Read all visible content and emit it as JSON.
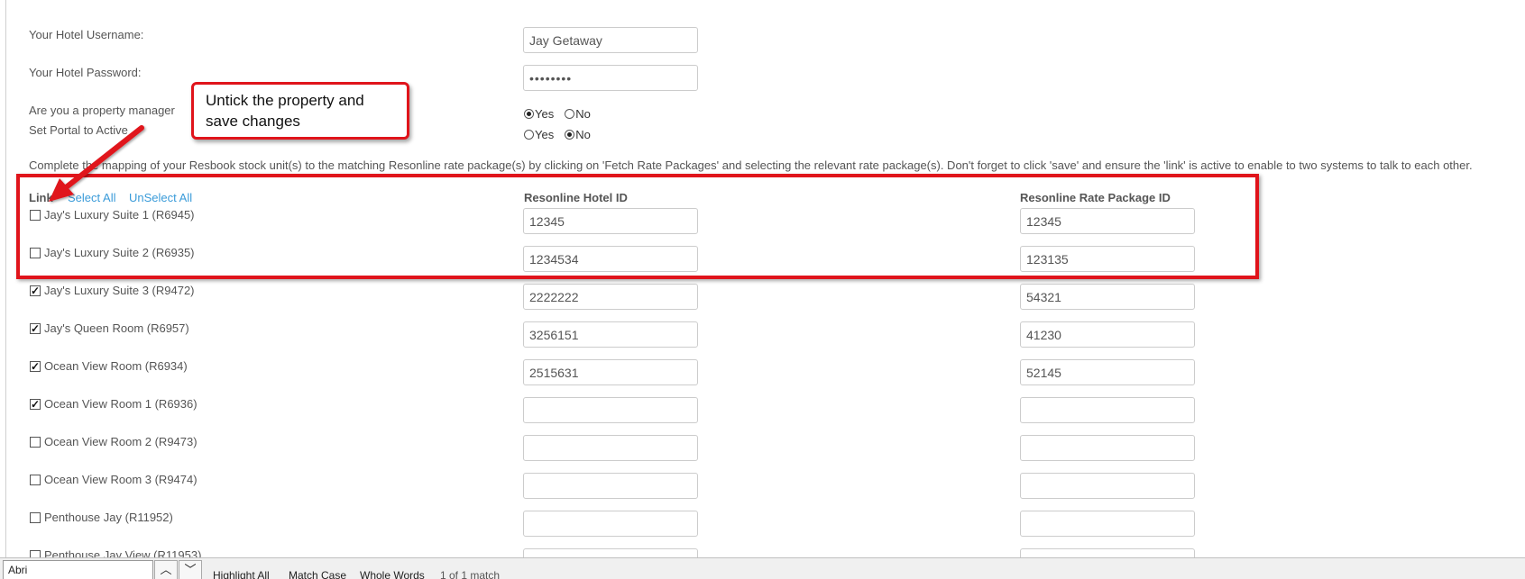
{
  "form": {
    "username_label": "Your Hotel Username:",
    "username_value": "Jay Getaway",
    "password_label": "Your Hotel Password:",
    "password_value": "••••••••",
    "property_manager_label": "Are you a property manager",
    "property_manager": {
      "yes": "Yes",
      "no": "No",
      "selected": "Yes"
    },
    "portal_active_label": "Set Portal to Active",
    "portal_active": {
      "yes": "Yes",
      "no": "No",
      "selected": "No"
    },
    "instructions": "Complete the mapping of your Resbook stock unit(s) to the matching Resonline rate package(s) by clicking on 'Fetch Rate Packages' and selecting the relevant rate package(s). Don't forget to click 'save' and ensure the 'link' is active to enable to two systems to talk to each other."
  },
  "mapping": {
    "link_header": "Link",
    "select_all": "Select All",
    "unselect_all": "UnSelect All",
    "hotel_id_header": "Resonline Hotel ID",
    "rate_package_header": "Resonline Rate Package ID",
    "rows": [
      {
        "label": "Jay's Luxury Suite 1 (R6945)",
        "checked": false,
        "hotel_id": "12345",
        "rate_id": "12345"
      },
      {
        "label": "Jay's Luxury Suite 2 (R6935)",
        "checked": false,
        "hotel_id": "1234534",
        "rate_id": "123135"
      },
      {
        "label": "Jay's Luxury Suite 3 (R9472)",
        "checked": true,
        "hotel_id": "2222222",
        "rate_id": "54321"
      },
      {
        "label": "Jay's Queen Room (R6957)",
        "checked": true,
        "hotel_id": "3256151",
        "rate_id": "41230"
      },
      {
        "label": "Ocean View Room (R6934)",
        "checked": true,
        "hotel_id": "2515631",
        "rate_id": "52145"
      },
      {
        "label": "Ocean View Room 1 (R6936)",
        "checked": true,
        "hotel_id": "",
        "rate_id": ""
      },
      {
        "label": "Ocean View Room 2 (R9473)",
        "checked": false,
        "hotel_id": "",
        "rate_id": ""
      },
      {
        "label": "Ocean View Room 3 (R9474)",
        "checked": false,
        "hotel_id": "",
        "rate_id": ""
      },
      {
        "label": "Penthouse Jay (R11952)",
        "checked": false,
        "hotel_id": "",
        "rate_id": ""
      },
      {
        "label": "Penthouse Jay View (R11953)",
        "checked": false,
        "hotel_id": "",
        "rate_id": ""
      }
    ]
  },
  "annotation": {
    "callout_line1": "Untick the property and",
    "callout_line2": "save changes",
    "color": "#e0141b"
  },
  "findbar": {
    "query": "Abri",
    "up_icon": "chevron-up-icon",
    "down_icon": "chevron-down-icon",
    "highlight_all": "Highlight All",
    "match_case": "Match Case",
    "whole_words": "Whole Words",
    "status": "1 of 1 match"
  }
}
